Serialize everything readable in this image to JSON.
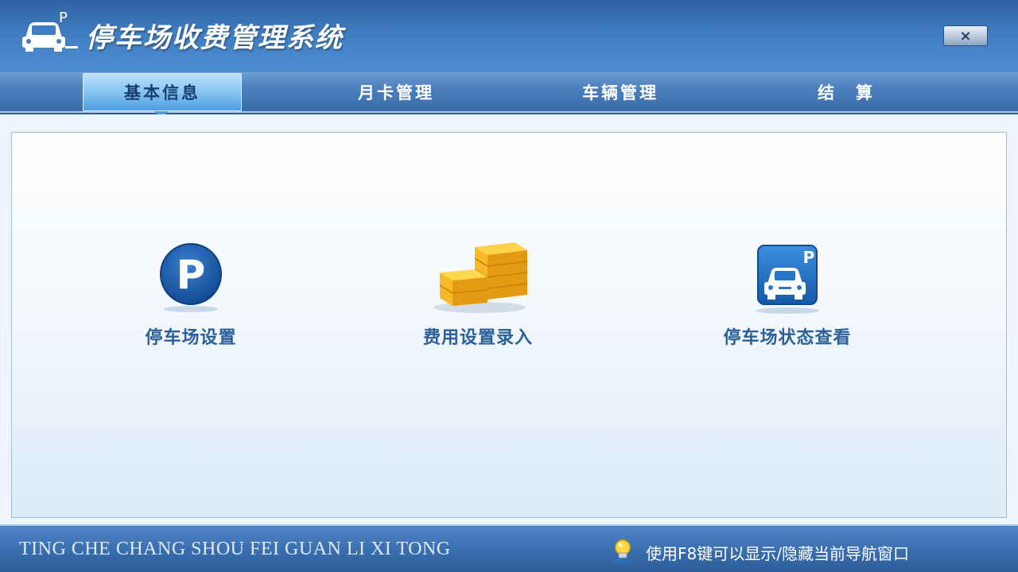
{
  "window": {
    "title": "停车场收费管理系统",
    "close_label": "×"
  },
  "tabs": [
    {
      "label": "基本信息",
      "active": true
    },
    {
      "label": "月卡管理",
      "active": false
    },
    {
      "label": "车辆管理",
      "active": false
    },
    {
      "label": "结　算",
      "active": false
    }
  ],
  "features": [
    {
      "label": "停车场设置",
      "icon": "parking-p-icon"
    },
    {
      "label": "费用设置录入",
      "icon": "gold-coins-icon"
    },
    {
      "label": "停车场状态查看",
      "icon": "car-parking-icon"
    }
  ],
  "status": {
    "pinyin": "TING CHE CHANG SHOU FEI  GUAN LI XI TONG",
    "hint": "使用F8键可以显示/隐藏当前导航窗口"
  },
  "colors": {
    "accent": "#2a5f9a",
    "titlebar": "#3f7cc0",
    "active_tab": "#8cc8f2",
    "coins": "#f5b81c"
  }
}
